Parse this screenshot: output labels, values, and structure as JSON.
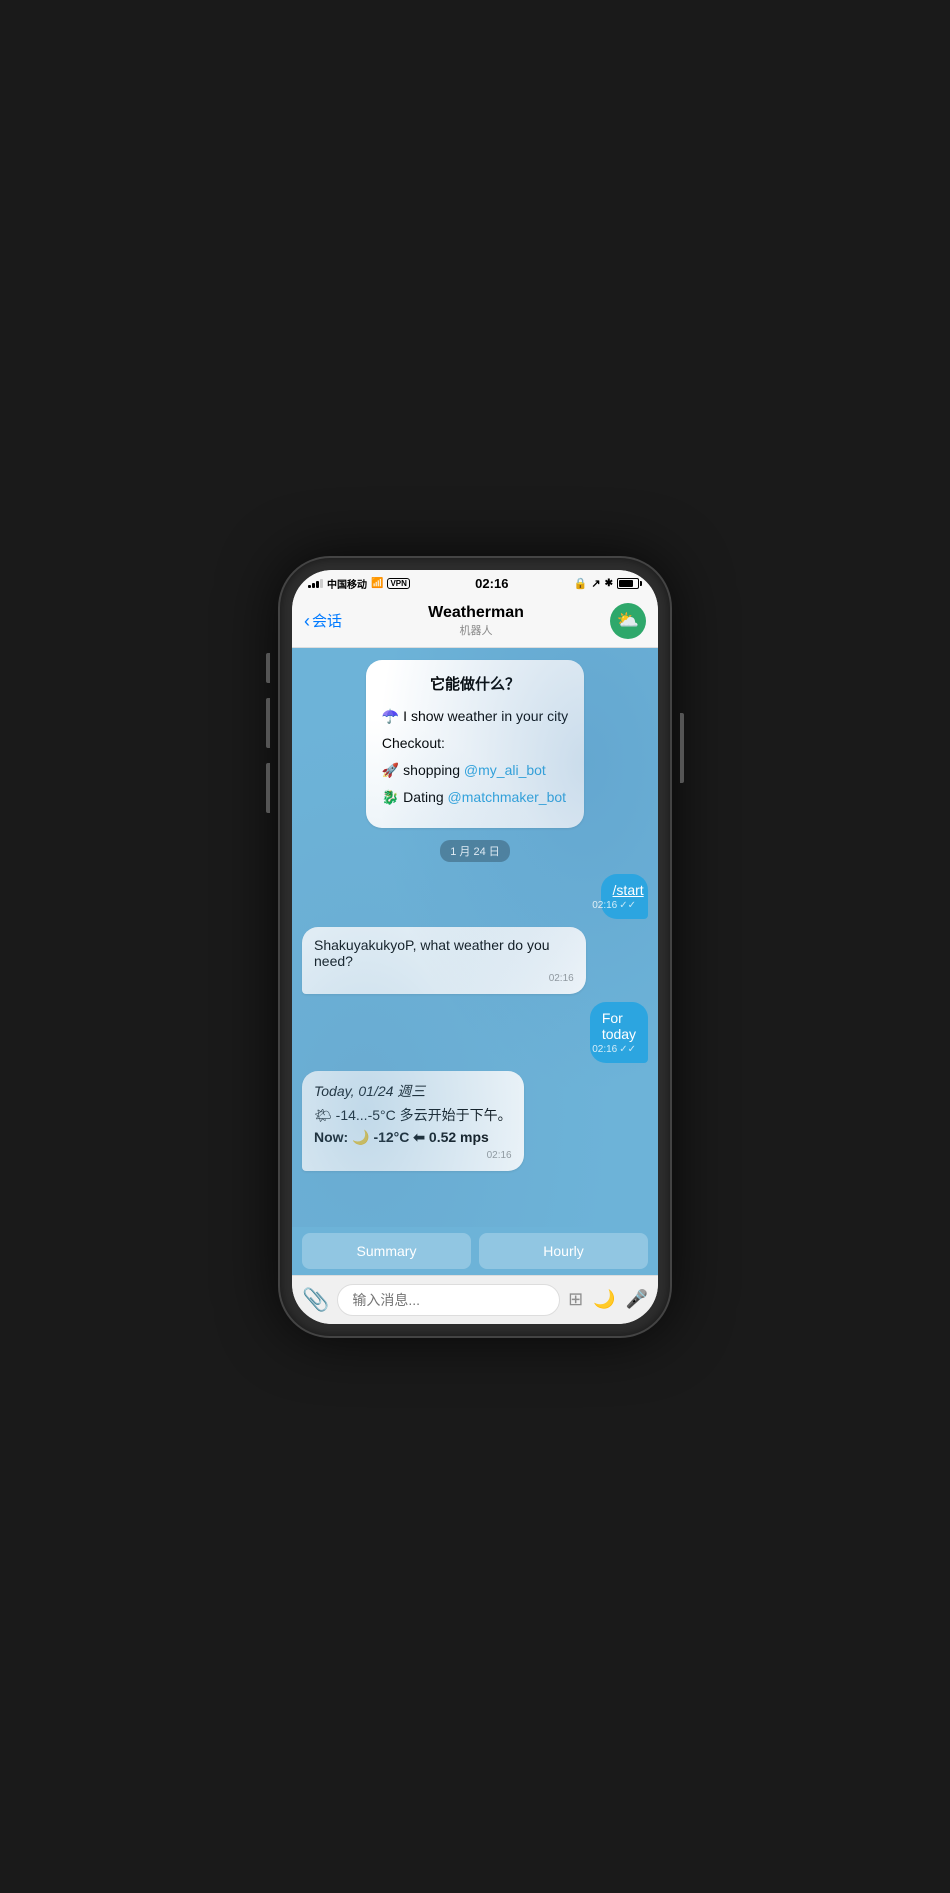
{
  "phone": {
    "status_bar": {
      "carrier": "中国移动",
      "wifi": "WiFi",
      "vpn": "VPN",
      "time": "02:16",
      "battery": "80"
    },
    "nav": {
      "back_label": "会话",
      "title": "Weatherman",
      "subtitle": "机器人",
      "avatar_emoji": "⛅"
    },
    "chat": {
      "welcome_title": "它能做什么？",
      "welcome_line1": "☂️ I show weather in your city",
      "welcome_checkout": "Checkout:",
      "welcome_shopping": "🚀 shopping",
      "welcome_shopping_link": "@my_ali_bot",
      "welcome_dating": "🐉 Dating",
      "welcome_dating_link": "@matchmaker_bot",
      "date_sep": "1 月 24 日",
      "msg_start": "/start",
      "msg_start_time": "02:16",
      "msg_start_check": "✓✓",
      "bot_reply1": "ShakuyakukyoP, what weather do you need?",
      "bot_reply1_time": "02:16",
      "msg_fortoday": "For today",
      "msg_fortoday_time": "02:16",
      "msg_fortoday_check": "✓✓",
      "bot_reply2_line1": "Today, 01/24 週三",
      "bot_reply2_line2": "🌤 -14...-5°C 多云开始于下午。",
      "bot_reply2_line3_prefix": "Now:",
      "bot_reply2_moon": "🌙",
      "bot_reply2_temp": "-12°C",
      "bot_reply2_arrow": "⬅",
      "bot_reply2_wind": "0.52 mps",
      "bot_reply2_time": "02:16",
      "quick_reply1": "Summary",
      "quick_reply2": "Hourly"
    },
    "input": {
      "placeholder": "输入消息..."
    }
  }
}
